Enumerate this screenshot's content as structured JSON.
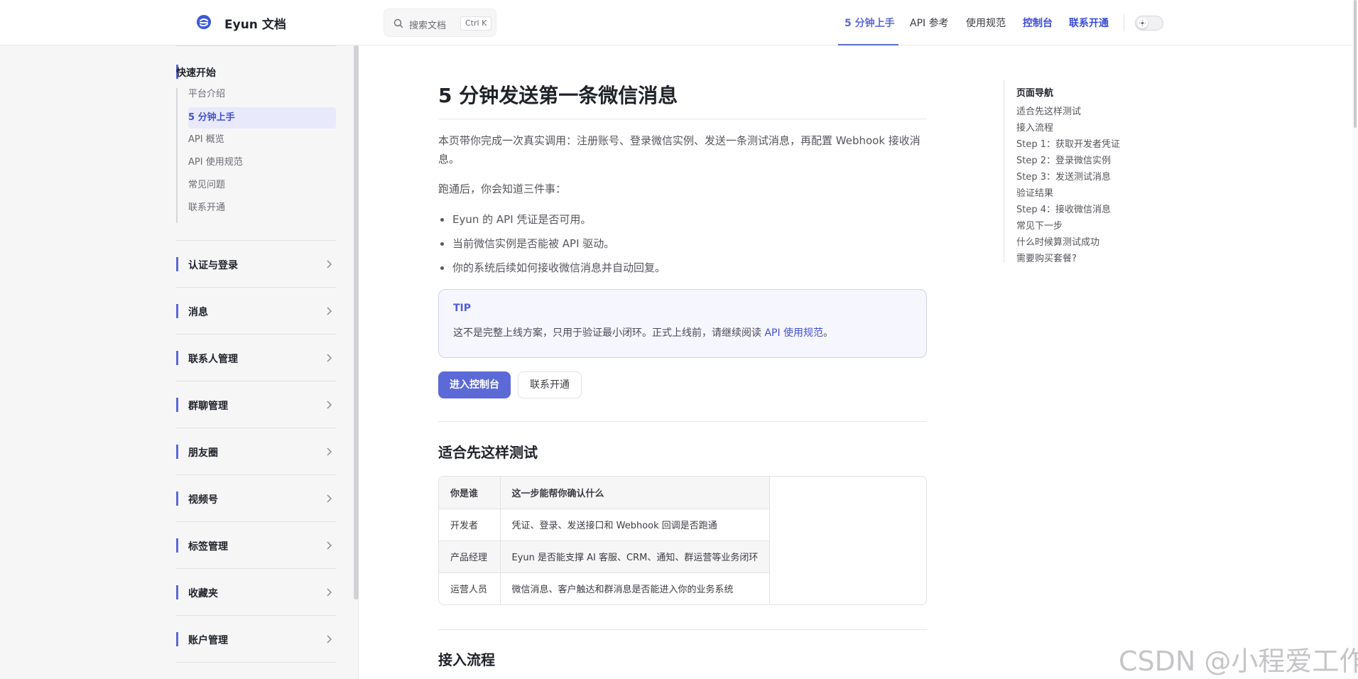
{
  "brand": {
    "name": "Eyun 文档"
  },
  "search": {
    "placeholder": "搜索文档",
    "shortcut": "Ctrl K"
  },
  "nav": {
    "items": [
      {
        "label": "5 分钟上手",
        "state": "active"
      },
      {
        "label": "API 参考",
        "state": "normal"
      },
      {
        "label": "使用规范",
        "state": "normal"
      },
      {
        "label": "控制台",
        "state": "accent"
      },
      {
        "label": "联系开通",
        "state": "accent"
      }
    ]
  },
  "sidebar": {
    "section_title": "快速开始",
    "items": [
      {
        "label": "平台介绍"
      },
      {
        "label": "5 分钟上手",
        "active": true
      },
      {
        "label": "API 概览"
      },
      {
        "label": "API 使用规范"
      },
      {
        "label": "常见问题"
      },
      {
        "label": "联系开通"
      }
    ],
    "groups": [
      {
        "label": "认证与登录"
      },
      {
        "label": "消息"
      },
      {
        "label": "联系人管理"
      },
      {
        "label": "群聊管理"
      },
      {
        "label": "朋友圈"
      },
      {
        "label": "视频号"
      },
      {
        "label": "标签管理"
      },
      {
        "label": "收藏夹"
      },
      {
        "label": "账户管理"
      }
    ]
  },
  "main": {
    "title": "5 分钟发送第一条微信消息",
    "intro_line1": "本页带你完成一次真实调用：注册账号、登录微信实例、发送一条测试消息，再配置 Webhook 接收消",
    "intro_line2": "息。",
    "after_label": "跑通后，你会知道三件事：",
    "bullets": [
      "Eyun 的 API 凭证是否可用。",
      "当前微信实例是否能被 API 驱动。",
      "你的系统后续如何接收微信消息并自动回复。"
    ],
    "tip": {
      "title": "TIP",
      "text": "这不是完整上线方案，只用于验证最小闭环。正式上线前，请继续阅读 ",
      "link": "API 使用规范",
      "suffix": "。"
    },
    "buttons": {
      "primary": "进入控制台",
      "secondary": "联系开通"
    },
    "section1_title": "适合先这样测试",
    "table": {
      "headers": [
        "你是谁",
        "这一步能帮你确认什么"
      ],
      "rows": [
        [
          "开发者",
          "凭证、登录、发送接口和 Webhook 回调是否跑通"
        ],
        [
          "产品经理",
          "Eyun 是否能支撑 AI 客服、CRM、通知、群运营等业务闭环"
        ],
        [
          "运营人员",
          "微信消息、客户触达和群消息是否能进入你的业务系统"
        ]
      ]
    },
    "section2_title": "接入流程"
  },
  "outline": {
    "title": "页面导航",
    "items": [
      "适合先这样测试",
      "接入流程",
      "Step 1：获取开发者凭证",
      "Step 2：登录微信实例",
      "Step 3：发送测试消息",
      "验证结果",
      "Step 4：接收微信消息",
      "常见下一步",
      "什么时候算测试成功",
      "需要购买套餐?"
    ]
  },
  "watermark": "CSDN @小程爱工作",
  "colors": {
    "accent": "#5b6ad6",
    "link": "#4352cf"
  }
}
